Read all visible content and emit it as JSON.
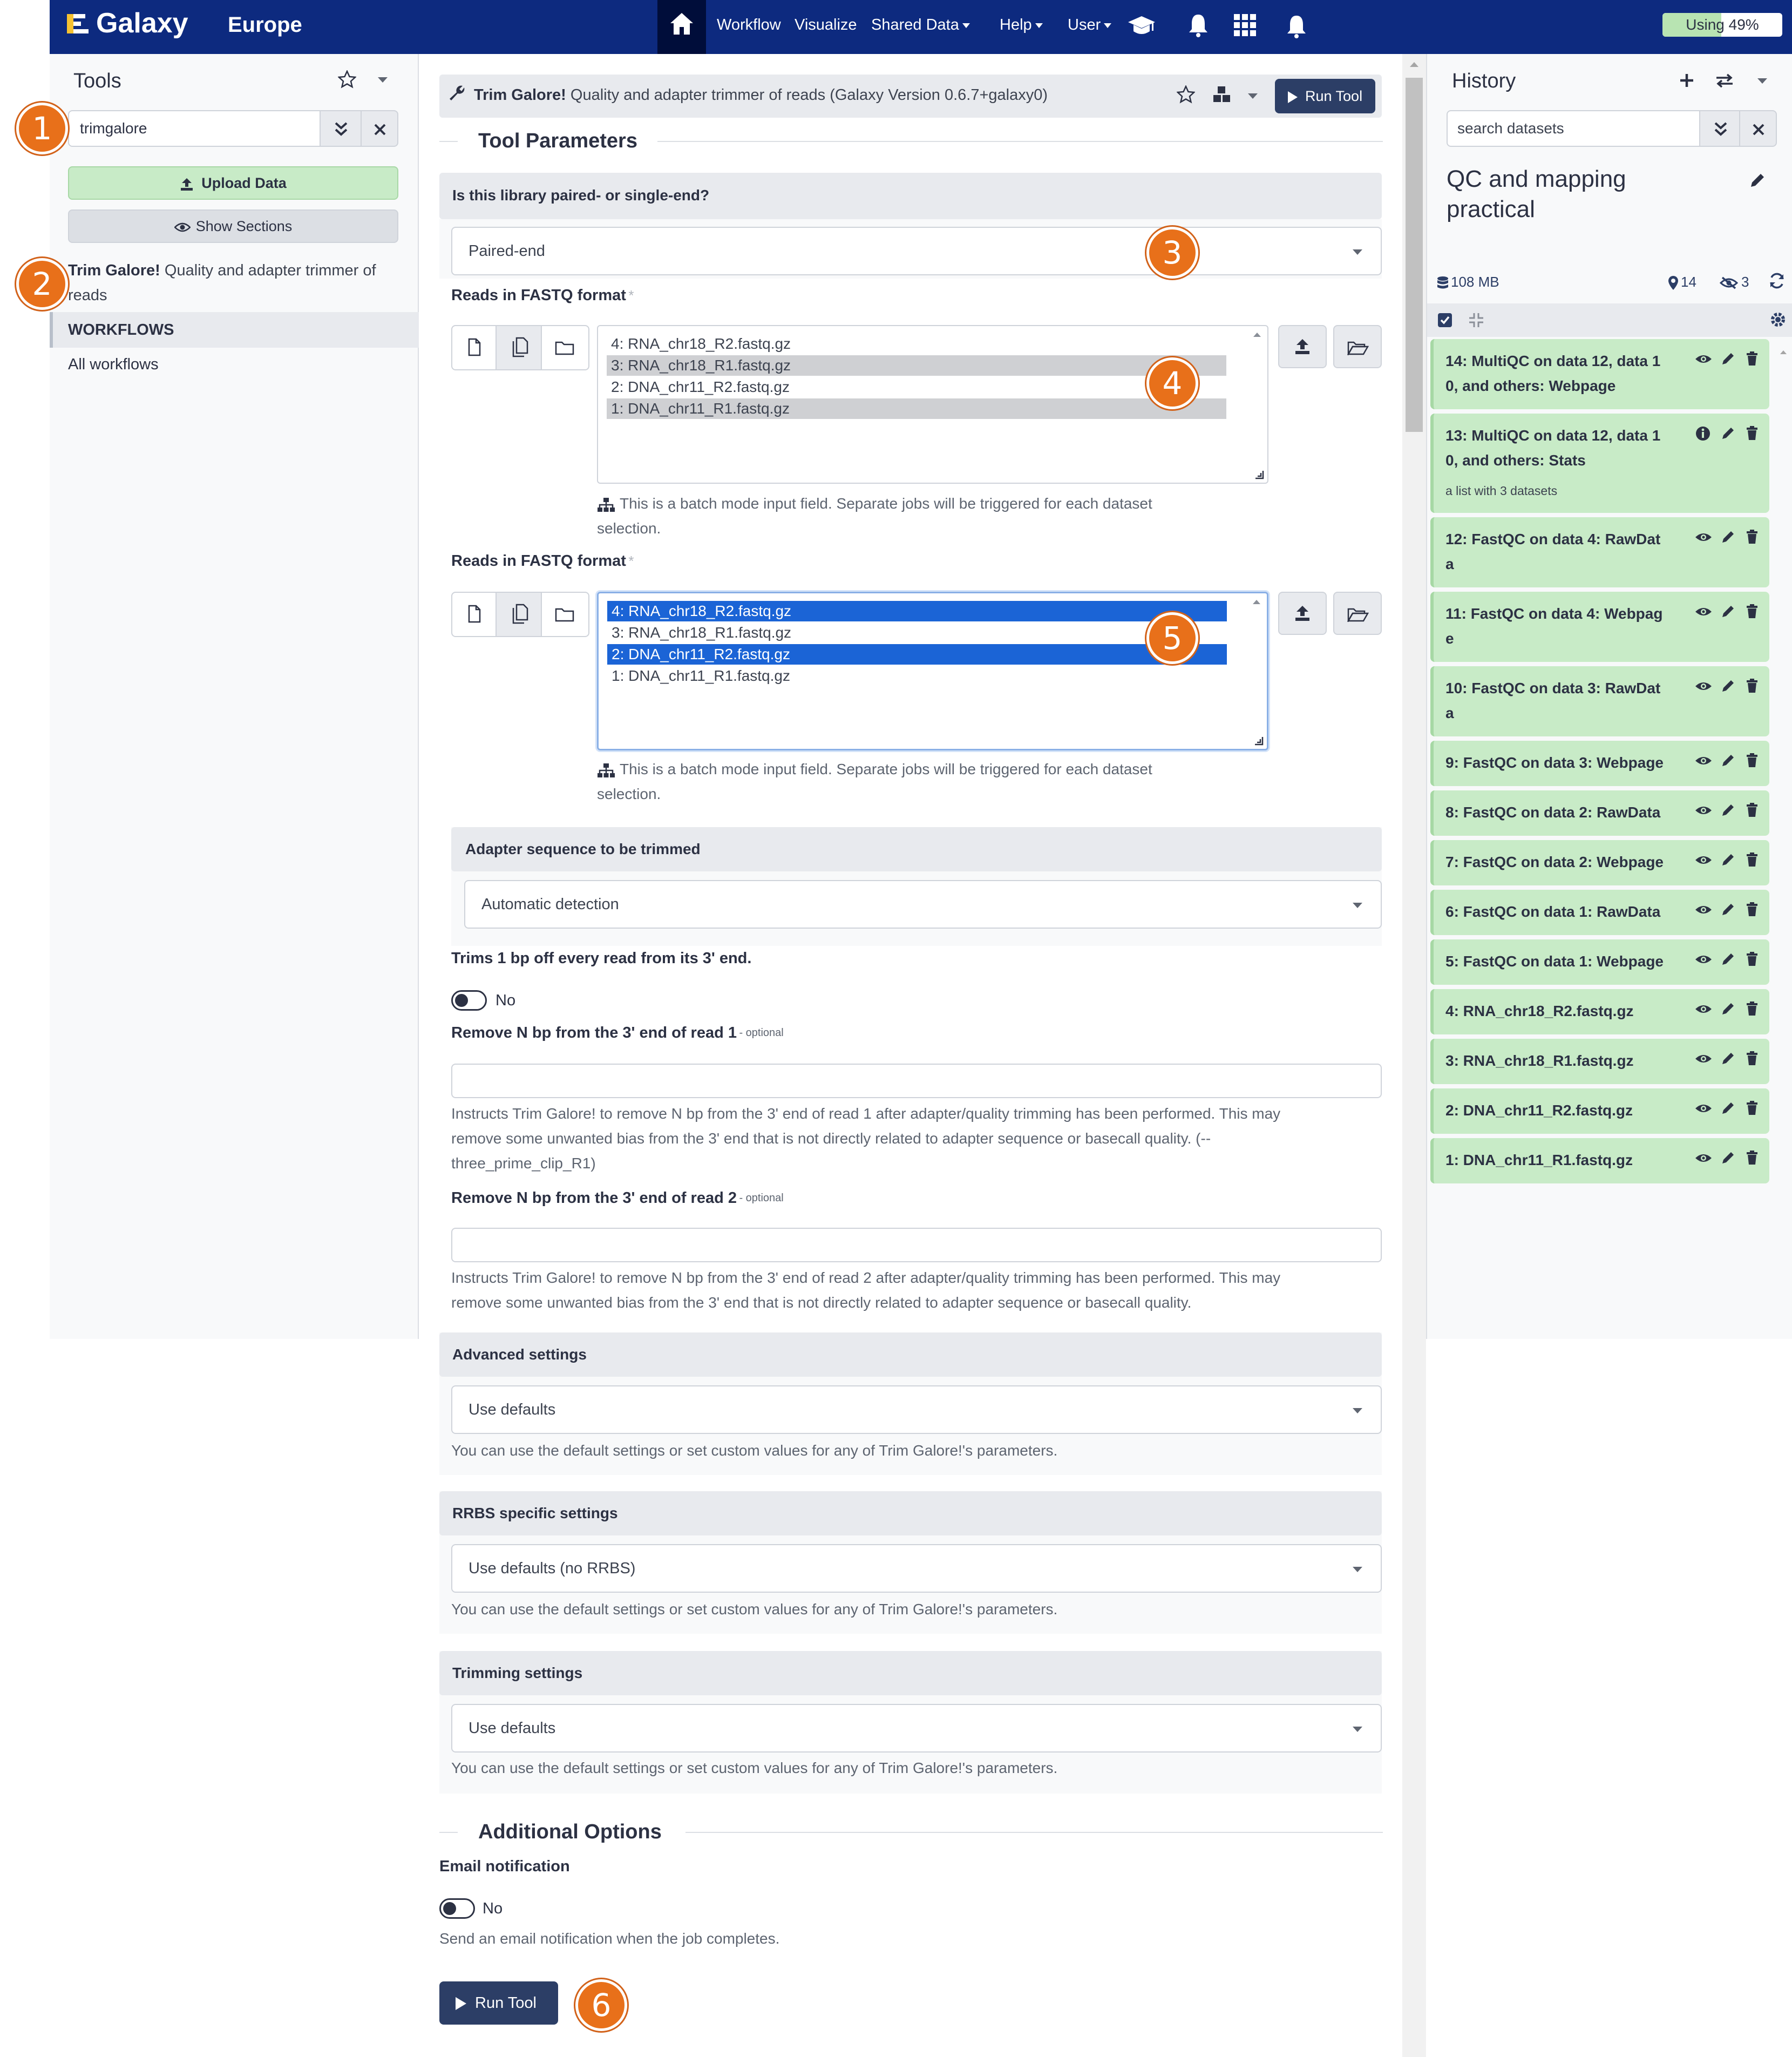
{
  "masthead": {
    "brand": "Galaxy",
    "brand_suffix": "Europe",
    "nav": [
      {
        "label": "Workflow",
        "has_caret": false
      },
      {
        "label": "Visualize",
        "has_caret": false
      },
      {
        "label": "Shared Data",
        "has_caret": true
      },
      {
        "label": "Help",
        "has_caret": true
      },
      {
        "label": "User",
        "has_caret": true
      }
    ],
    "quota_label": "Using 49%",
    "quota_fraction": 0.49,
    "icons": [
      "home-icon",
      "graduation-cap-icon",
      "bell-icon",
      "grid-icon",
      "bell-icon"
    ]
  },
  "tool_panel": {
    "title": "Tools",
    "search_value": "trimgalore",
    "upload_label": "Upload Data",
    "sections_label": "Show Sections",
    "result_tool_name": "Trim Galore!",
    "result_tool_desc_line1": "Quality and adapter trimmer of",
    "result_tool_desc_line2": "reads",
    "workflows_header": "WORKFLOWS",
    "all_workflows_label": "All workflows"
  },
  "tool_form": {
    "tool_name": "Trim Galore!",
    "tool_desc": "Quality and adapter trimmer of reads (Galaxy Version 0.6.7+galaxy0)",
    "run_label": "Run Tool",
    "params_heading": "Tool Parameters",
    "paired_question": "Is this library paired- or single-end?",
    "paired_value": "Paired-end",
    "reads1_label": "Reads in FASTQ format",
    "reads2_label": "Reads in FASTQ format",
    "required_mark": "*",
    "reads1_options": [
      {
        "label": "4: RNA_chr18_R2.fastq.gz",
        "state": "none"
      },
      {
        "label": "3: RNA_chr18_R1.fastq.gz",
        "state": "grey"
      },
      {
        "label": "2: DNA_chr11_R2.fastq.gz",
        "state": "none"
      },
      {
        "label": "1: DNA_chr11_R1.fastq.gz",
        "state": "grey"
      }
    ],
    "reads2_options": [
      {
        "label": "4: RNA_chr18_R2.fastq.gz",
        "state": "blue"
      },
      {
        "label": "3: RNA_chr18_R1.fastq.gz",
        "state": "none"
      },
      {
        "label": "2: DNA_chr11_R2.fastq.gz",
        "state": "blue"
      },
      {
        "label": "1: DNA_chr11_R1.fastq.gz",
        "state": "none"
      }
    ],
    "batch_help_line1": "This is a batch mode input field. Separate jobs will be triggered for each dataset",
    "batch_help_line2": "selection.",
    "adapter_heading": "Adapter sequence to be trimmed",
    "adapter_value": "Automatic detection",
    "trim1bp_label": "Trims 1 bp off every read from its 3' end.",
    "trim1bp_toggle": "No",
    "clip_r1_label": "Remove N bp from the 3' end of read 1",
    "clip_r2_label": "Remove N bp from the 3' end of read 2",
    "optional_mark": "- optional",
    "clip_r1_help_line1": "Instructs Trim Galore! to remove N bp from the 3' end of read 1 after adapter/quality trimming has been performed. This may",
    "clip_r1_help_line2": "remove some unwanted bias from the 3' end that is not directly related to adapter sequence or basecall quality. (--",
    "clip_r1_help_line3": "three_prime_clip_R1)",
    "clip_r2_help_line1": "Instructs Trim Galore! to remove N bp from the 3' end of read 2 after adapter/quality trimming has been performed. This may",
    "clip_r2_help_line2": "remove some unwanted bias from the 3' end that is not directly related to adapter sequence or basecall quality.",
    "advanced_heading": "Advanced settings",
    "advanced_value": "Use defaults",
    "defaults_help": "You can use the default settings or set custom values for any of Trim Galore!'s parameters.",
    "rrbs_heading": "RRBS specific settings",
    "rrbs_value": "Use defaults (no RRBS)",
    "trimming_heading": "Trimming settings",
    "trimming_value": "Use defaults",
    "additional_heading": "Additional Options",
    "email_label": "Email notification",
    "email_toggle": "No",
    "email_help": "Send an email notification when the job completes."
  },
  "history": {
    "title": "History",
    "search_placeholder": "search datasets",
    "name_line1": "QC and mapping",
    "name_line2": "practical",
    "size": "108 MB",
    "shown_count": "14",
    "hidden_count": "3",
    "items": [
      {
        "line1": "14: MultiQC on data 12, data 1",
        "line2": "0, and others: Webpage",
        "sub": "",
        "info": false
      },
      {
        "line1": "13: MultiQC on data 12, data 1",
        "line2": "0, and others: Stats",
        "sub": "a list with 3 datasets",
        "info": true
      },
      {
        "line1": "12: FastQC on data 4: RawDat",
        "line2": "a",
        "sub": "",
        "info": false
      },
      {
        "line1": "11: FastQC on data 4: Webpag",
        "line2": "e",
        "sub": "",
        "info": false
      },
      {
        "line1": "10: FastQC on data 3: RawDat",
        "line2": "a",
        "sub": "",
        "info": false
      },
      {
        "line1": "9: FastQC on data 3: Webpage",
        "line2": "",
        "sub": "",
        "info": false
      },
      {
        "line1": "8: FastQC on data 2: RawData",
        "line2": "",
        "sub": "",
        "info": false
      },
      {
        "line1": "7: FastQC on data 2: Webpage",
        "line2": "",
        "sub": "",
        "info": false
      },
      {
        "line1": "6: FastQC on data 1: RawData",
        "line2": "",
        "sub": "",
        "info": false
      },
      {
        "line1": "5: FastQC on data 1: Webpage",
        "line2": "",
        "sub": "",
        "info": false
      },
      {
        "line1": "4: RNA_chr18_R2.fastq.gz",
        "line2": "",
        "sub": "",
        "info": false
      },
      {
        "line1": "3: RNA_chr18_R1.fastq.gz",
        "line2": "",
        "sub": "",
        "info": false
      },
      {
        "line1": "2: DNA_chr11_R2.fastq.gz",
        "line2": "",
        "sub": "",
        "info": false
      },
      {
        "line1": "1: DNA_chr11_R1.fastq.gz",
        "line2": "",
        "sub": "",
        "info": false
      }
    ]
  },
  "callouts": [
    "1",
    "2",
    "3",
    "4",
    "5",
    "6"
  ],
  "colors": {
    "masthead": "#0d2a7f",
    "dataset_ok": "#c8ebc7",
    "primary": "#2c3e66",
    "upload_green": "#c8ebc7",
    "callout_orange": "#e8701a",
    "selected_blue": "#1b64d6"
  }
}
